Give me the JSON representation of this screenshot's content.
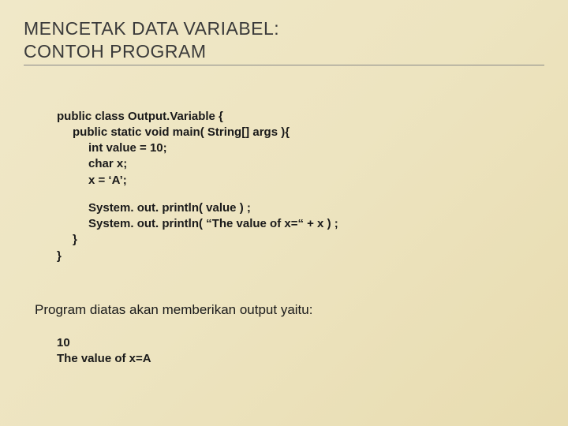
{
  "title": {
    "line1": "MENCETAK DATA VARIABEL:",
    "line2": "CONTOH PROGRAM"
  },
  "code": {
    "l1": "public class Output.Variable {",
    "l2": "public static void main( String[] args ){",
    "l3": "int value = 10;",
    "l4": "char x;",
    "l5": "x = ‘A’;",
    "l6": "System. out. println( value ) ;",
    "l7": "System. out. println( “The value of x=“ + x ) ;",
    "l8": "}",
    "l9": "}"
  },
  "description": "Program diatas akan memberikan output yaitu:",
  "output": {
    "l1": "10",
    "l2": "The value of x=A"
  }
}
